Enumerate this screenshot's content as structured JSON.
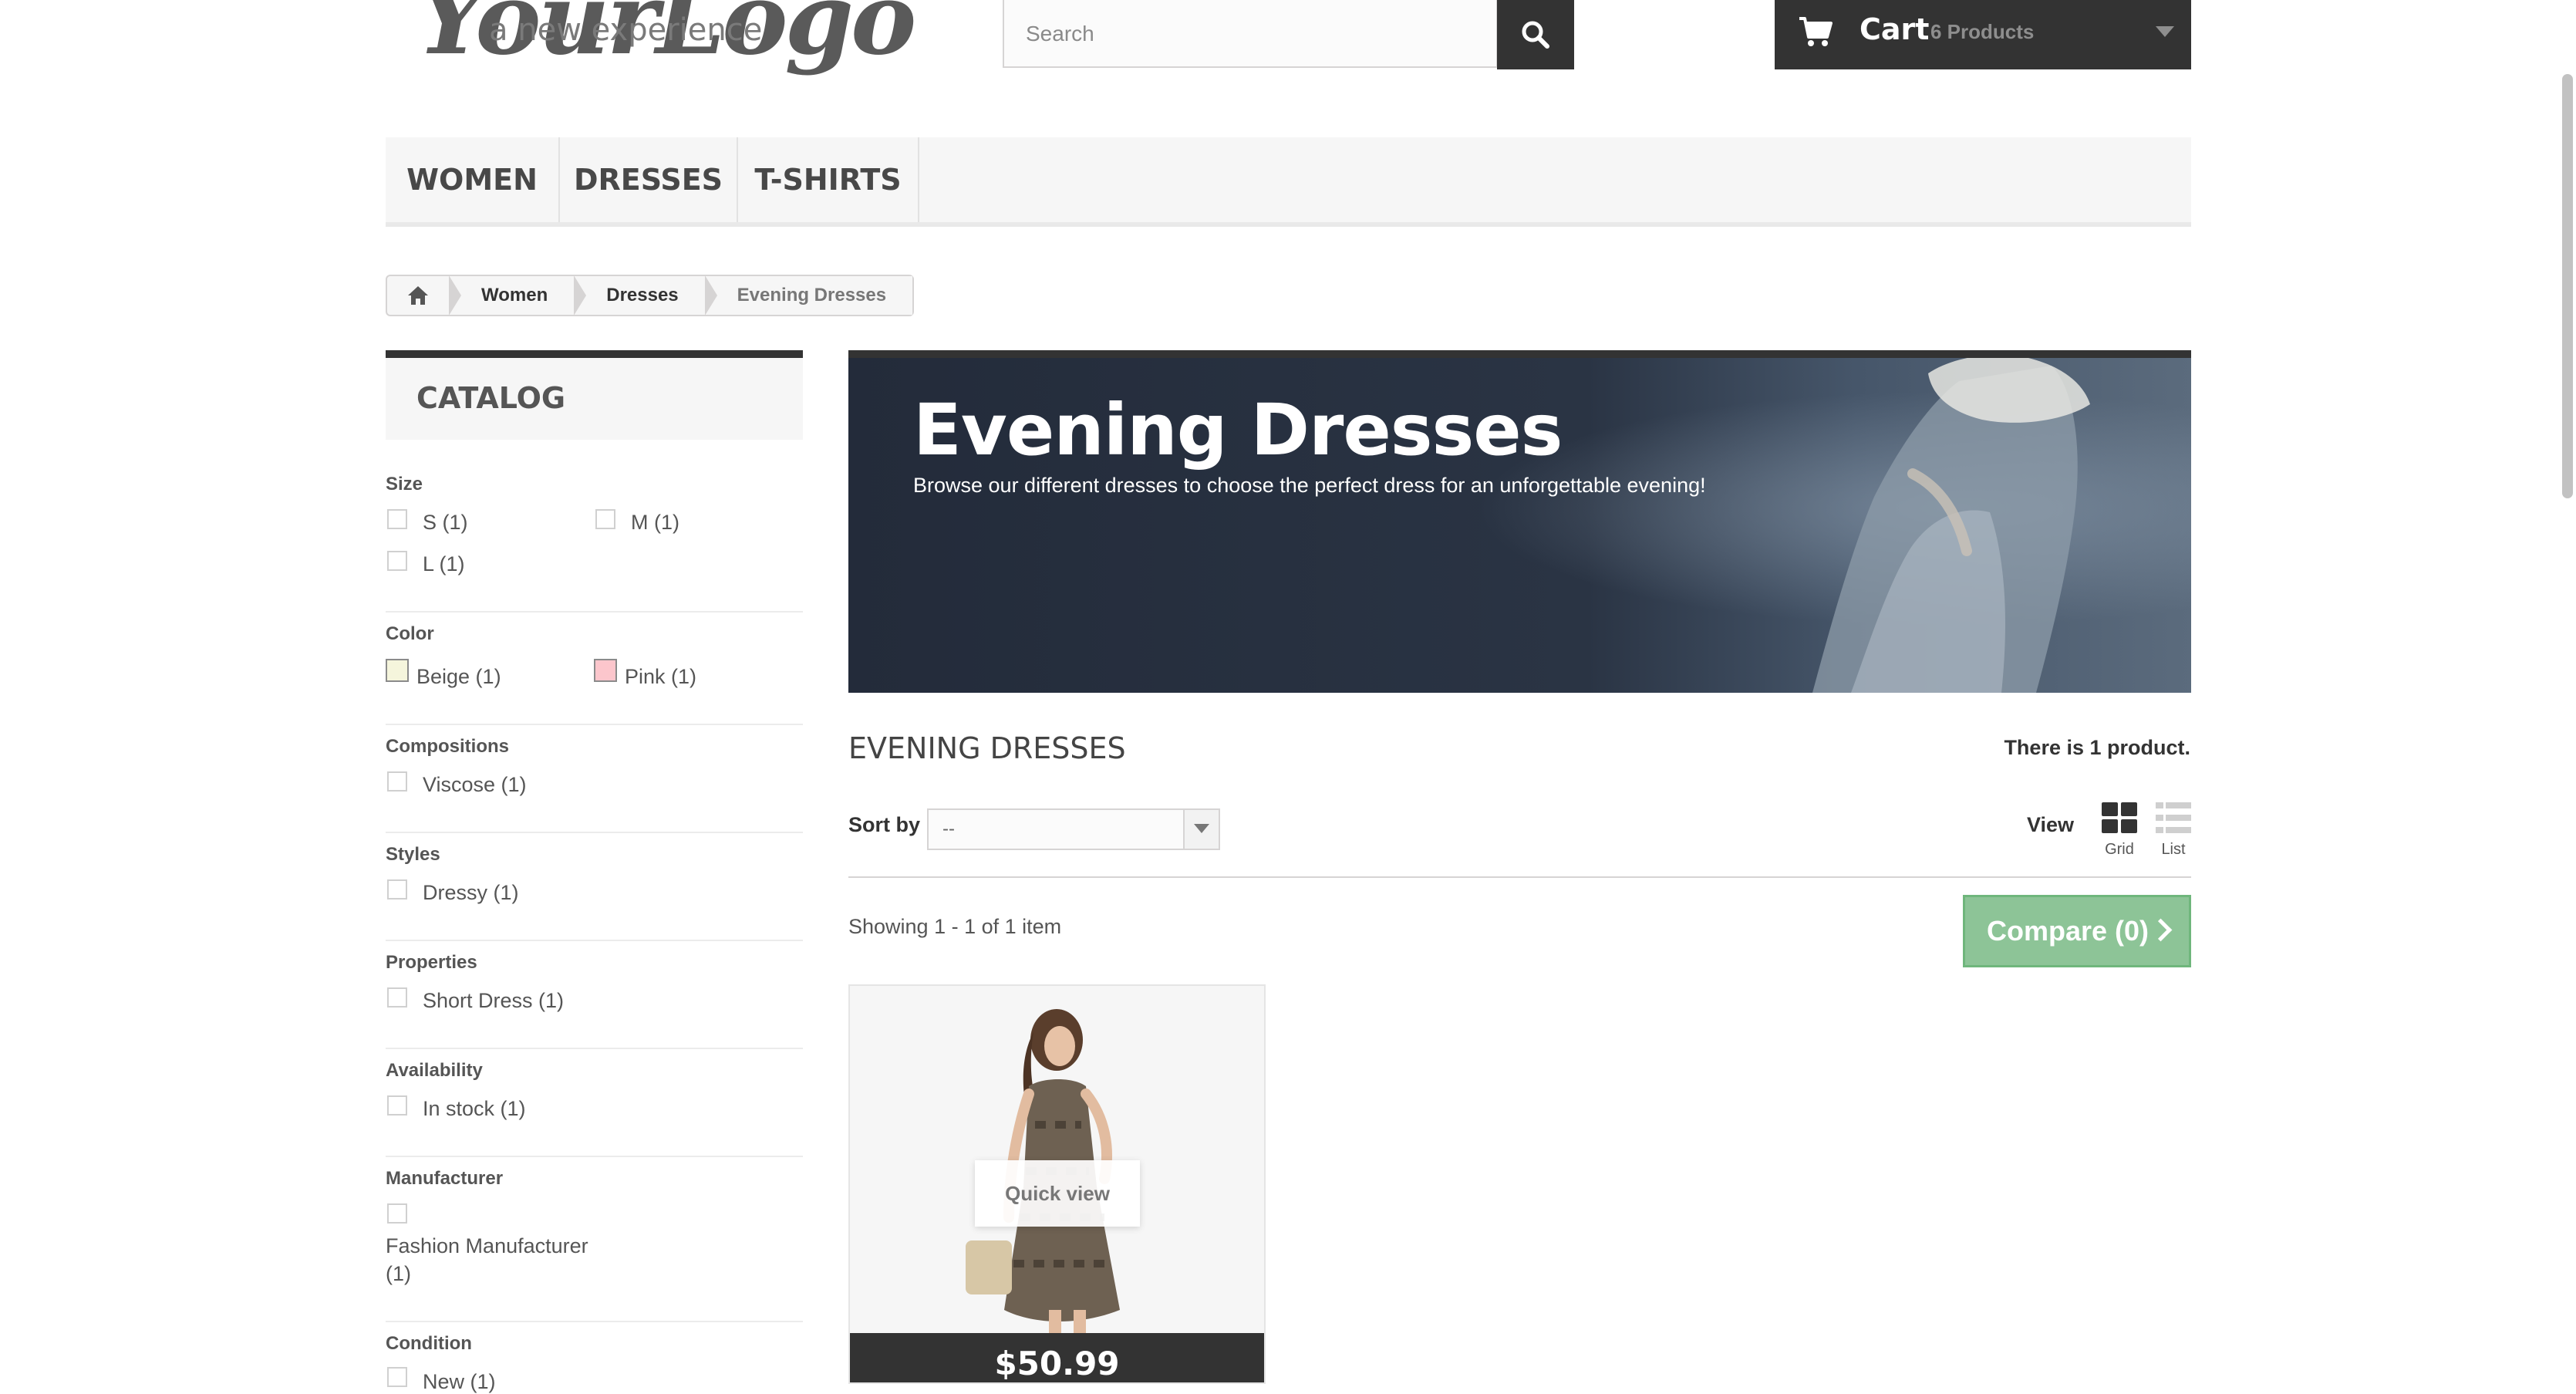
{
  "logo": {
    "main_text": "YourLogo",
    "tagline": "a new experience"
  },
  "search": {
    "placeholder": "Search"
  },
  "cart": {
    "label": "Cart",
    "count_text": "6 Products"
  },
  "menu": {
    "items": [
      "WOMEN",
      "DRESSES",
      "T-SHIRTS"
    ]
  },
  "breadcrumb": {
    "items": [
      "Women",
      "Dresses",
      "Evening Dresses"
    ]
  },
  "catalog": {
    "title": "CATALOG",
    "filters": {
      "size": {
        "title": "Size",
        "options": [
          "S (1)",
          "M (1)",
          "L (1)"
        ]
      },
      "color": {
        "title": "Color",
        "options": [
          {
            "label": "Beige (1)",
            "color": "#f5f5dc"
          },
          {
            "label": "Pink (1)",
            "color": "#fcc6cc"
          }
        ]
      },
      "compositions": {
        "title": "Compositions",
        "options": [
          "Viscose (1)"
        ]
      },
      "styles": {
        "title": "Styles",
        "options": [
          "Dressy (1)"
        ]
      },
      "properties": {
        "title": "Properties",
        "options": [
          "Short Dress (1)"
        ]
      },
      "availability": {
        "title": "Availability",
        "options": [
          "In stock (1)"
        ]
      },
      "manufacturer": {
        "title": "Manufacturer",
        "options": [
          "Fashion Manufacturer",
          "(1)"
        ]
      },
      "condition": {
        "title": "Condition",
        "options": [
          "New (1)"
        ]
      }
    }
  },
  "banner": {
    "title": "Evening Dresses",
    "description": "Browse our different dresses to choose the perfect dress for an unforgettable evening!"
  },
  "category": {
    "name": "EVENING DRESSES",
    "product_count": "There is 1 product.",
    "sort_label": "Sort by",
    "sort_value": "--",
    "view_label": "View",
    "view_grid": "Grid",
    "view_list": "List",
    "showing": "Showing 1 - 1 of 1 item",
    "compare": "Compare (0)"
  },
  "product": {
    "quick_view": "Quick view",
    "price": "$50.99"
  },
  "colors": {
    "dark": "#333333",
    "compare_green": "#8dc497",
    "banner_bg": "#27303f"
  }
}
